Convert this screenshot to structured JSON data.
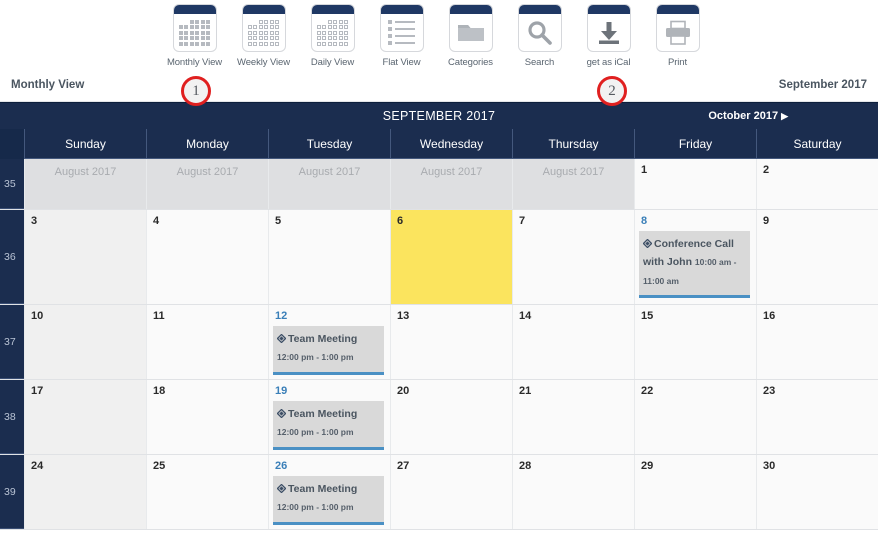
{
  "toolbar": {
    "items": [
      {
        "label": "Monthly View",
        "icon": "monthly-view-icon"
      },
      {
        "label": "Weekly View",
        "icon": "weekly-view-icon"
      },
      {
        "label": "Daily View",
        "icon": "daily-view-icon"
      },
      {
        "label": "Flat View",
        "icon": "flat-view-icon"
      },
      {
        "label": "Categories",
        "icon": "folder-icon"
      },
      {
        "label": "Search",
        "icon": "search-icon"
      },
      {
        "label": "get as iCal",
        "icon": "download-icon"
      },
      {
        "label": "Print",
        "icon": "printer-icon"
      }
    ]
  },
  "subheader": {
    "view_name": "Monthly View",
    "period": "September 2017"
  },
  "annotations": [
    {
      "number": "1"
    },
    {
      "number": "2"
    }
  ],
  "calendar": {
    "title": "SEPTEMBER 2017",
    "next_label": "October 2017",
    "next_arrow": "▶",
    "day_headers": [
      "Sunday",
      "Monday",
      "Tuesday",
      "Wednesday",
      "Thursday",
      "Friday",
      "Saturday"
    ],
    "weeks": [
      {
        "week_number": "35",
        "days": [
          {
            "num": "August 2017",
            "type": "othermonth"
          },
          {
            "num": "August 2017",
            "type": "othermonth"
          },
          {
            "num": "August 2017",
            "type": "othermonth"
          },
          {
            "num": "August 2017",
            "type": "othermonth"
          },
          {
            "num": "August 2017",
            "type": "othermonth"
          },
          {
            "num": "1",
            "type": "normal"
          },
          {
            "num": "2",
            "type": "normal"
          }
        ]
      },
      {
        "week_number": "36",
        "days": [
          {
            "num": "3",
            "type": "shaded"
          },
          {
            "num": "4",
            "type": "normal"
          },
          {
            "num": "5",
            "type": "normal"
          },
          {
            "num": "6",
            "type": "today"
          },
          {
            "num": "7",
            "type": "normal"
          },
          {
            "num": "8",
            "type": "linked",
            "event": {
              "title": "Conference Call with John",
              "time": "10:00 am - 11:00 am",
              "icon": "event-diamond-icon"
            }
          },
          {
            "num": "9",
            "type": "normal"
          }
        ]
      },
      {
        "week_number": "37",
        "days": [
          {
            "num": "10",
            "type": "shaded"
          },
          {
            "num": "11",
            "type": "normal"
          },
          {
            "num": "12",
            "type": "linked",
            "event": {
              "title": "Team Meeting",
              "time": "12:00 pm - 1:00 pm",
              "icon": "event-diamond-icon"
            }
          },
          {
            "num": "13",
            "type": "normal"
          },
          {
            "num": "14",
            "type": "normal"
          },
          {
            "num": "15",
            "type": "normal"
          },
          {
            "num": "16",
            "type": "normal"
          }
        ]
      },
      {
        "week_number": "38",
        "days": [
          {
            "num": "17",
            "type": "shaded"
          },
          {
            "num": "18",
            "type": "normal"
          },
          {
            "num": "19",
            "type": "linked",
            "event": {
              "title": "Team Meeting",
              "time": "12:00 pm - 1:00 pm",
              "icon": "event-diamond-icon"
            }
          },
          {
            "num": "20",
            "type": "normal"
          },
          {
            "num": "21",
            "type": "normal"
          },
          {
            "num": "22",
            "type": "normal"
          },
          {
            "num": "23",
            "type": "normal"
          }
        ]
      },
      {
        "week_number": "39",
        "days": [
          {
            "num": "24",
            "type": "shaded"
          },
          {
            "num": "25",
            "type": "normal"
          },
          {
            "num": "26",
            "type": "linked",
            "event": {
              "title": "Team Meeting",
              "time": "12:00 pm - 1:00 pm",
              "icon": "event-diamond-icon"
            }
          },
          {
            "num": "27",
            "type": "normal"
          },
          {
            "num": "28",
            "type": "normal"
          },
          {
            "num": "29",
            "type": "normal"
          },
          {
            "num": "30",
            "type": "normal"
          }
        ]
      }
    ]
  },
  "colors": {
    "navy": "#1b2d4f",
    "today_yellow": "#fbe45e",
    "event_accent": "#4a90c4",
    "annotation_red": "#e02020",
    "link_blue": "#3a7fb8"
  }
}
